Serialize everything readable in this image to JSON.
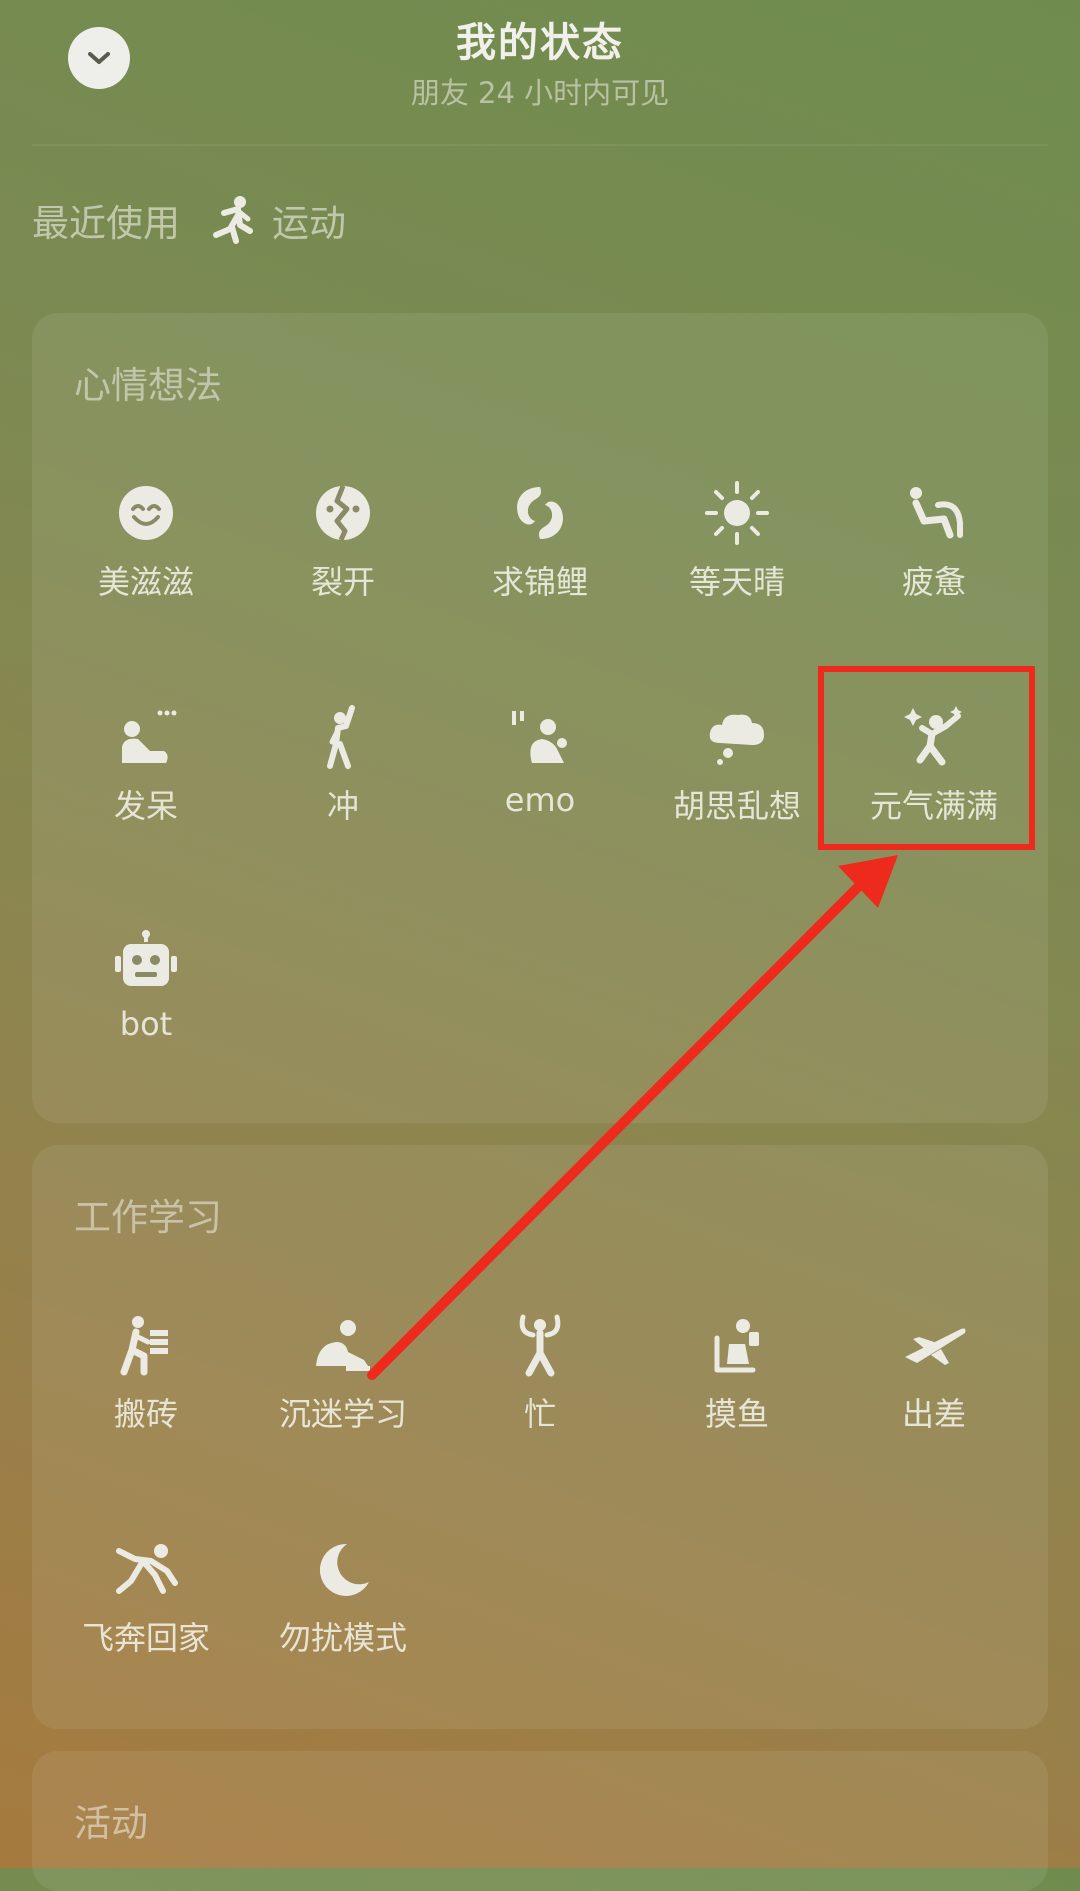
{
  "header": {
    "title": "我的状态",
    "subtitle": "朋友 24 小时内可见",
    "collapse_icon": "chevron-down-icon"
  },
  "recent": {
    "label": "最近使用",
    "items": [
      {
        "label": "运动",
        "icon": "running-icon"
      }
    ]
  },
  "sections": [
    {
      "title": "心情想法",
      "items": [
        {
          "label": "美滋滋",
          "icon": "smile-face-icon"
        },
        {
          "label": "裂开",
          "icon": "cracked-face-icon"
        },
        {
          "label": "求锦鲤",
          "icon": "koi-fish-icon"
        },
        {
          "label": "等天晴",
          "icon": "sun-icon"
        },
        {
          "label": "疲惫",
          "icon": "tired-person-icon"
        },
        {
          "label": "发呆",
          "icon": "daze-person-icon"
        },
        {
          "label": "冲",
          "icon": "charge-person-icon"
        },
        {
          "label": "emo",
          "icon": "emo-person-icon"
        },
        {
          "label": "胡思乱想",
          "icon": "thought-cloud-icon"
        },
        {
          "label": "元气满满",
          "icon": "energetic-person-icon"
        },
        {
          "label": "bot",
          "icon": "robot-icon"
        }
      ]
    },
    {
      "title": "工作学习",
      "items": [
        {
          "label": "搬砖",
          "icon": "carry-bricks-icon"
        },
        {
          "label": "沉迷学习",
          "icon": "study-person-icon"
        },
        {
          "label": "忙",
          "icon": "busy-person-icon"
        },
        {
          "label": "摸鱼",
          "icon": "slacking-person-icon"
        },
        {
          "label": "出差",
          "icon": "airplane-icon"
        },
        {
          "label": "飞奔回家",
          "icon": "run-home-icon"
        },
        {
          "label": "勿扰模式",
          "icon": "moon-icon"
        }
      ]
    },
    {
      "title": "活动",
      "items": []
    }
  ],
  "colors": {
    "annotation": "#ee2a1c",
    "icon": "#f1f0ea"
  }
}
